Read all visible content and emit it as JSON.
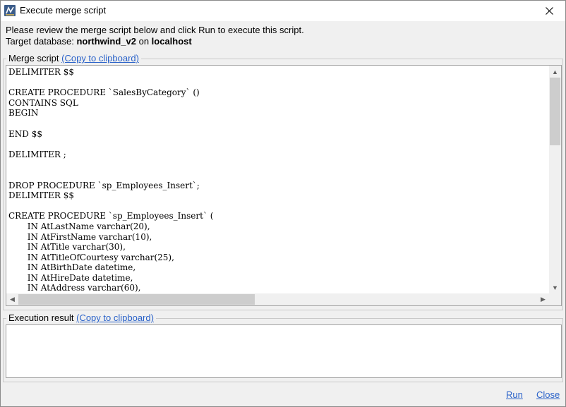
{
  "window": {
    "title": "Execute merge script",
    "close_glyph": "✕"
  },
  "intro": {
    "instruction": "Please review the merge script below and click Run to execute this script.",
    "target_prefix": "Target database: ",
    "database": "northwind_v2",
    "on_text": " on ",
    "host": "localhost"
  },
  "merge_script": {
    "label": "Merge script ",
    "copy_link": "(Copy to clipboard)",
    "content": "DELIMITER $$\n\nCREATE PROCEDURE `SalesByCategory` ()\nCONTAINS SQL\nBEGIN\n\nEND $$\n\nDELIMITER ;\n\n\nDROP PROCEDURE `sp_Employees_Insert`;\nDELIMITER $$\n\nCREATE PROCEDURE `sp_Employees_Insert` (\n       IN AtLastName varchar(20),\n       IN AtFirstName varchar(10),\n       IN AtTitle varchar(30),\n       IN AtTitleOfCourtesy varchar(25),\n       IN AtBirthDate datetime,\n       IN AtHireDate datetime,\n       IN AtAddress varchar(60),"
  },
  "execution_result": {
    "label": "Execution result ",
    "copy_link": "(Copy to clipboard)",
    "content": ""
  },
  "footer": {
    "run_label": "Run",
    "close_label": "Close"
  },
  "icons": {
    "scroll_up": "▲",
    "scroll_down": "▼",
    "scroll_left": "◀",
    "scroll_right": "▶"
  },
  "colors": {
    "link": "#2a62c9",
    "window_bg": "#f0f0f0"
  }
}
